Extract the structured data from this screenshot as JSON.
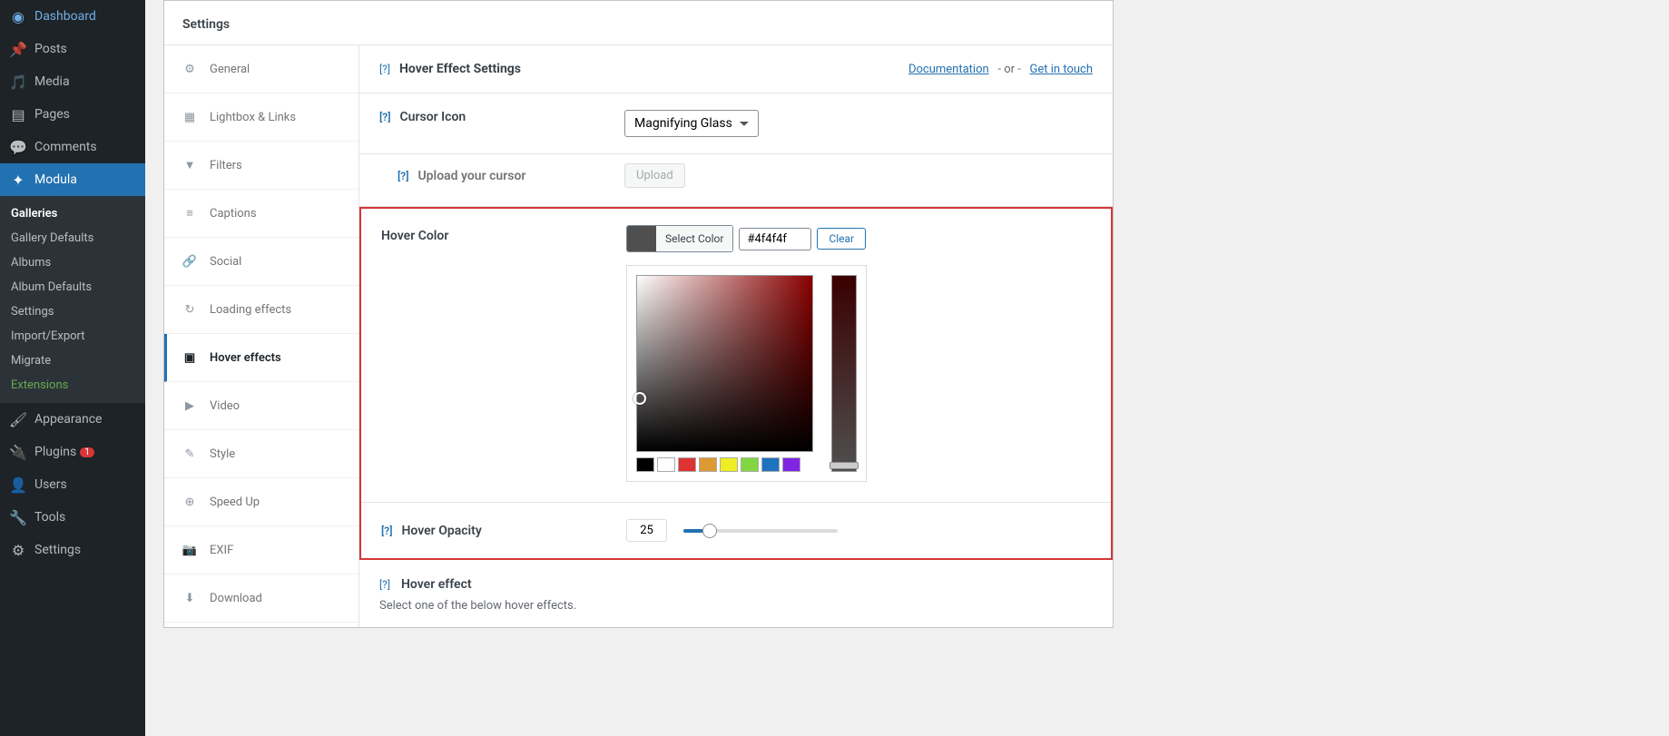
{
  "wp_menu": {
    "dashboard": "Dashboard",
    "posts": "Posts",
    "media": "Media",
    "pages": "Pages",
    "comments": "Comments",
    "modula": "Modula",
    "appearance": "Appearance",
    "plugins": "Plugins",
    "plugins_badge": "1",
    "users": "Users",
    "tools": "Tools",
    "settings": "Settings"
  },
  "wp_submenu": {
    "galleries": "Galleries",
    "gallery_defaults": "Gallery Defaults",
    "albums": "Albums",
    "album_defaults": "Album Defaults",
    "settings": "Settings",
    "import_export": "Import/Export",
    "migrate": "Migrate",
    "extensions": "Extensions"
  },
  "panel_title": "Settings",
  "tabs": {
    "general": "General",
    "lightbox": "Lightbox & Links",
    "filters": "Filters",
    "captions": "Captions",
    "social": "Social",
    "loading": "Loading effects",
    "hover": "Hover effects",
    "video": "Video",
    "style": "Style",
    "speedup": "Speed Up",
    "exif": "EXIF",
    "download": "Download"
  },
  "section": {
    "help": "[?]",
    "title": "Hover Effect Settings",
    "doc_link": "Documentation",
    "sep": "- or -",
    "touch_link": "Get in touch"
  },
  "fields": {
    "cursor_label": "Cursor Icon",
    "cursor_value": "Magnifying Glass",
    "upload_label": "Upload your cursor",
    "upload_button": "Upload",
    "hover_color_label": "Hover Color",
    "select_color": "Select Color",
    "hex_value": "#4f4f4f",
    "clear": "Clear",
    "hover_opacity_label": "Hover Opacity",
    "opacity_value": "25",
    "hover_effect_label": "Hover effect",
    "hover_effect_desc": "Select one of the below hover effects."
  },
  "palette": [
    "#000000",
    "#ffffff",
    "#dd3333",
    "#dd9933",
    "#eeee22",
    "#81d742",
    "#1e73be",
    "#8224e3"
  ]
}
